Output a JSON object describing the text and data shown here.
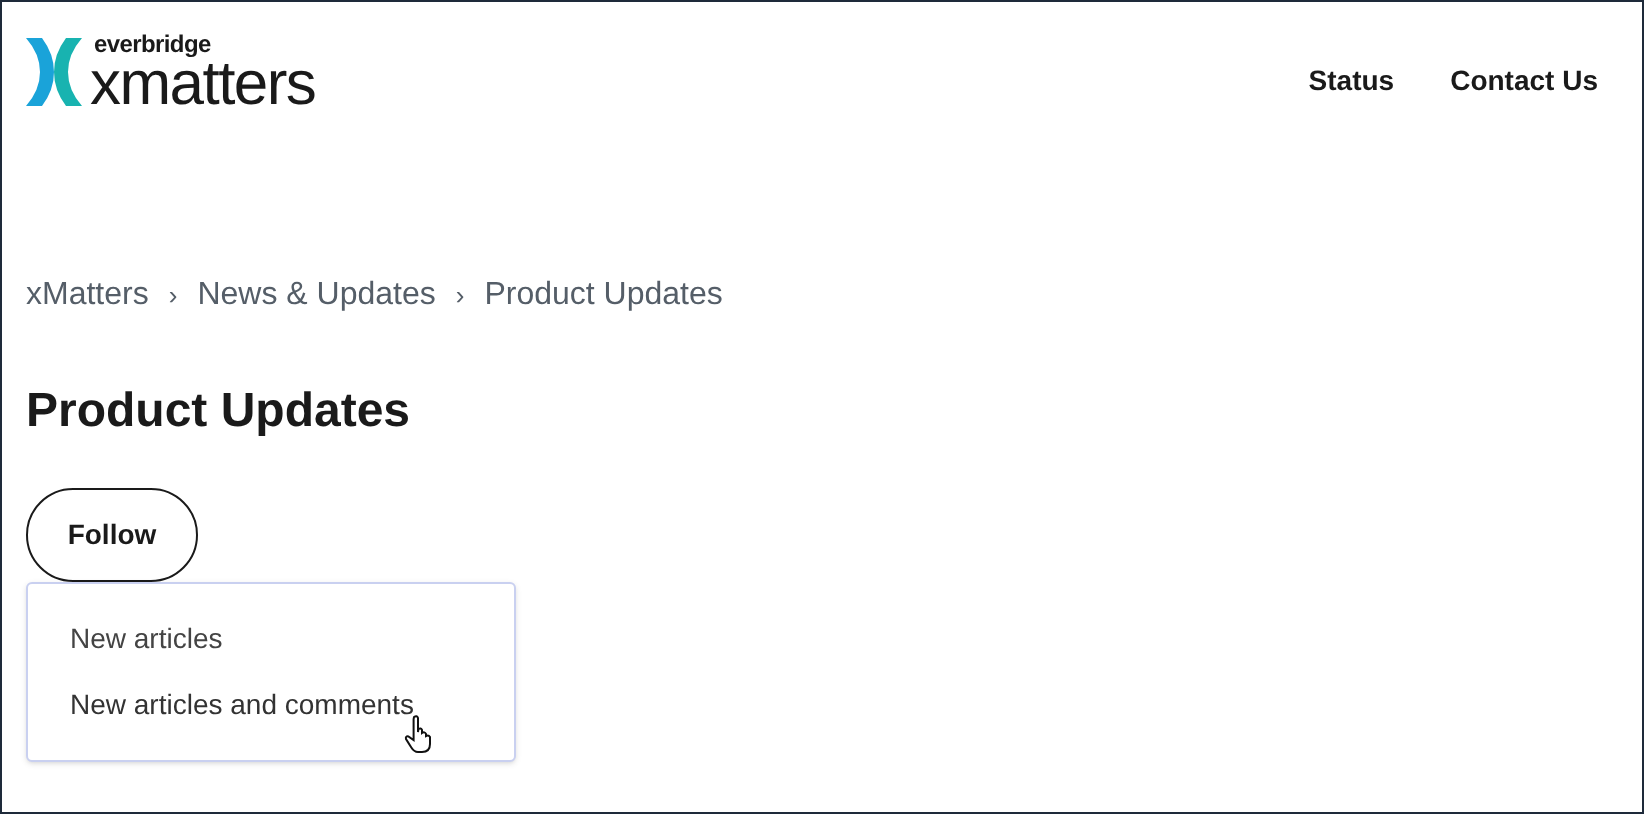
{
  "header": {
    "brand_top": "everbridge",
    "brand_name": "xmatters",
    "nav": [
      "Status",
      "Contact Us"
    ]
  },
  "breadcrumb": {
    "separator": "›",
    "items": [
      "xMatters",
      "News & Updates",
      "Product Updates"
    ]
  },
  "title": "Product Updates",
  "follow_button": {
    "label": "Follow",
    "expanded": true
  },
  "follow_menu": [
    {
      "label": "New articles",
      "hovered": false
    },
    {
      "label": "New articles and comments",
      "hovered": true
    }
  ]
}
